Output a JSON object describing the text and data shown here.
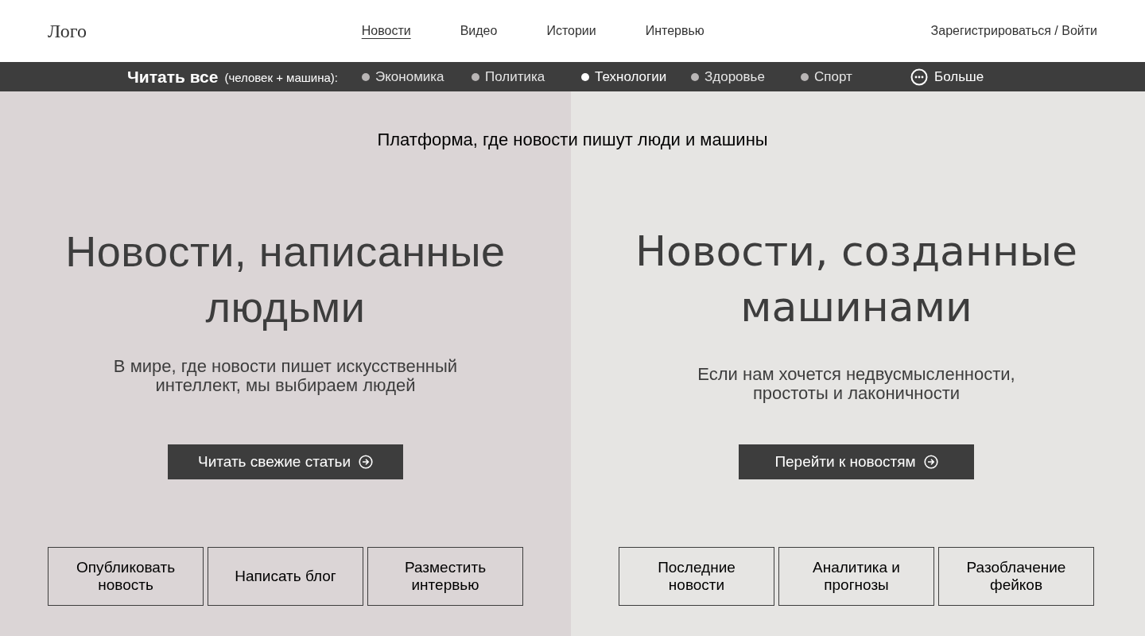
{
  "header": {
    "logo": "Лого",
    "nav": [
      {
        "label": "Новости",
        "selected": true
      },
      {
        "label": "Видео",
        "selected": false
      },
      {
        "label": "Истории",
        "selected": false
      },
      {
        "label": "Интервью",
        "selected": false
      }
    ],
    "auth": "Зарегистрироваться / Войти"
  },
  "category_bar": {
    "title": "Читать все",
    "subtitle": "(человек + машина):",
    "categories": [
      {
        "label": "Экономика",
        "selected": false
      },
      {
        "label": "Политика",
        "selected": false
      },
      {
        "label": "Технологии",
        "selected": true
      },
      {
        "label": "Здоровье",
        "selected": false
      },
      {
        "label": "Спорт",
        "selected": false
      }
    ],
    "more": "Больше"
  },
  "tagline": "Платформа, где новости пишут люди и машины",
  "panels": [
    {
      "kind": "human",
      "heading": "Новости, написанные людьми",
      "text": "В мире, где новости пишет искусственный интеллект, мы выбираем людей",
      "button": "Читать свежие статьи",
      "actions": [
        "Опубликовать новость",
        "Написать блог",
        "Разместить интервью"
      ]
    },
    {
      "kind": "machine",
      "heading": "Новости, созданные машинами",
      "text": "Если нам хочется недвусмысленности, простоты и лаконичности",
      "button": "Перейти к новостям",
      "actions": [
        "Последние новости",
        "Аналитика и прогнозы",
        "Разоблачение фейков"
      ]
    }
  ]
}
